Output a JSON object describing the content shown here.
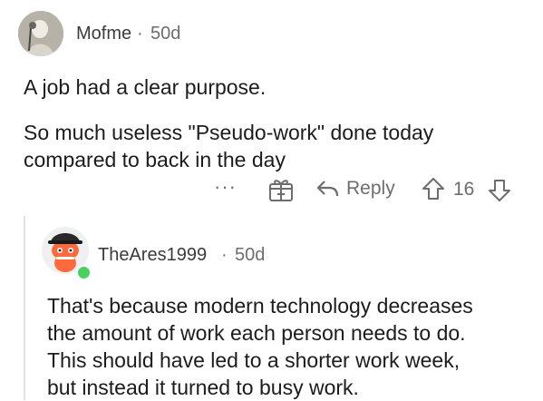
{
  "comment": {
    "username": "Mofme",
    "separator": "·",
    "age": "50d",
    "lines": [
      "A job had a clear purpose.",
      "So much useless \"Pseudo-work\" done today",
      "compared to back in the day"
    ],
    "actions": {
      "more": "···",
      "reply_label": "Reply",
      "vote_count": "16"
    }
  },
  "reply": {
    "username": "TheAres1999",
    "separator": "·",
    "age": "50d",
    "lines": [
      "That's because modern technology decreases",
      "the amount of work each person needs to do.",
      "This should have led to a shorter work week,",
      "but instead it turned to busy work."
    ],
    "online_color": "#46d160"
  },
  "icons": [
    "avatar-photo",
    "more-icon",
    "award-gift-icon",
    "reply-arrow-icon",
    "upvote-arrow-icon",
    "downvote-arrow-icon",
    "snoo-avatar",
    "online-status-icon"
  ]
}
